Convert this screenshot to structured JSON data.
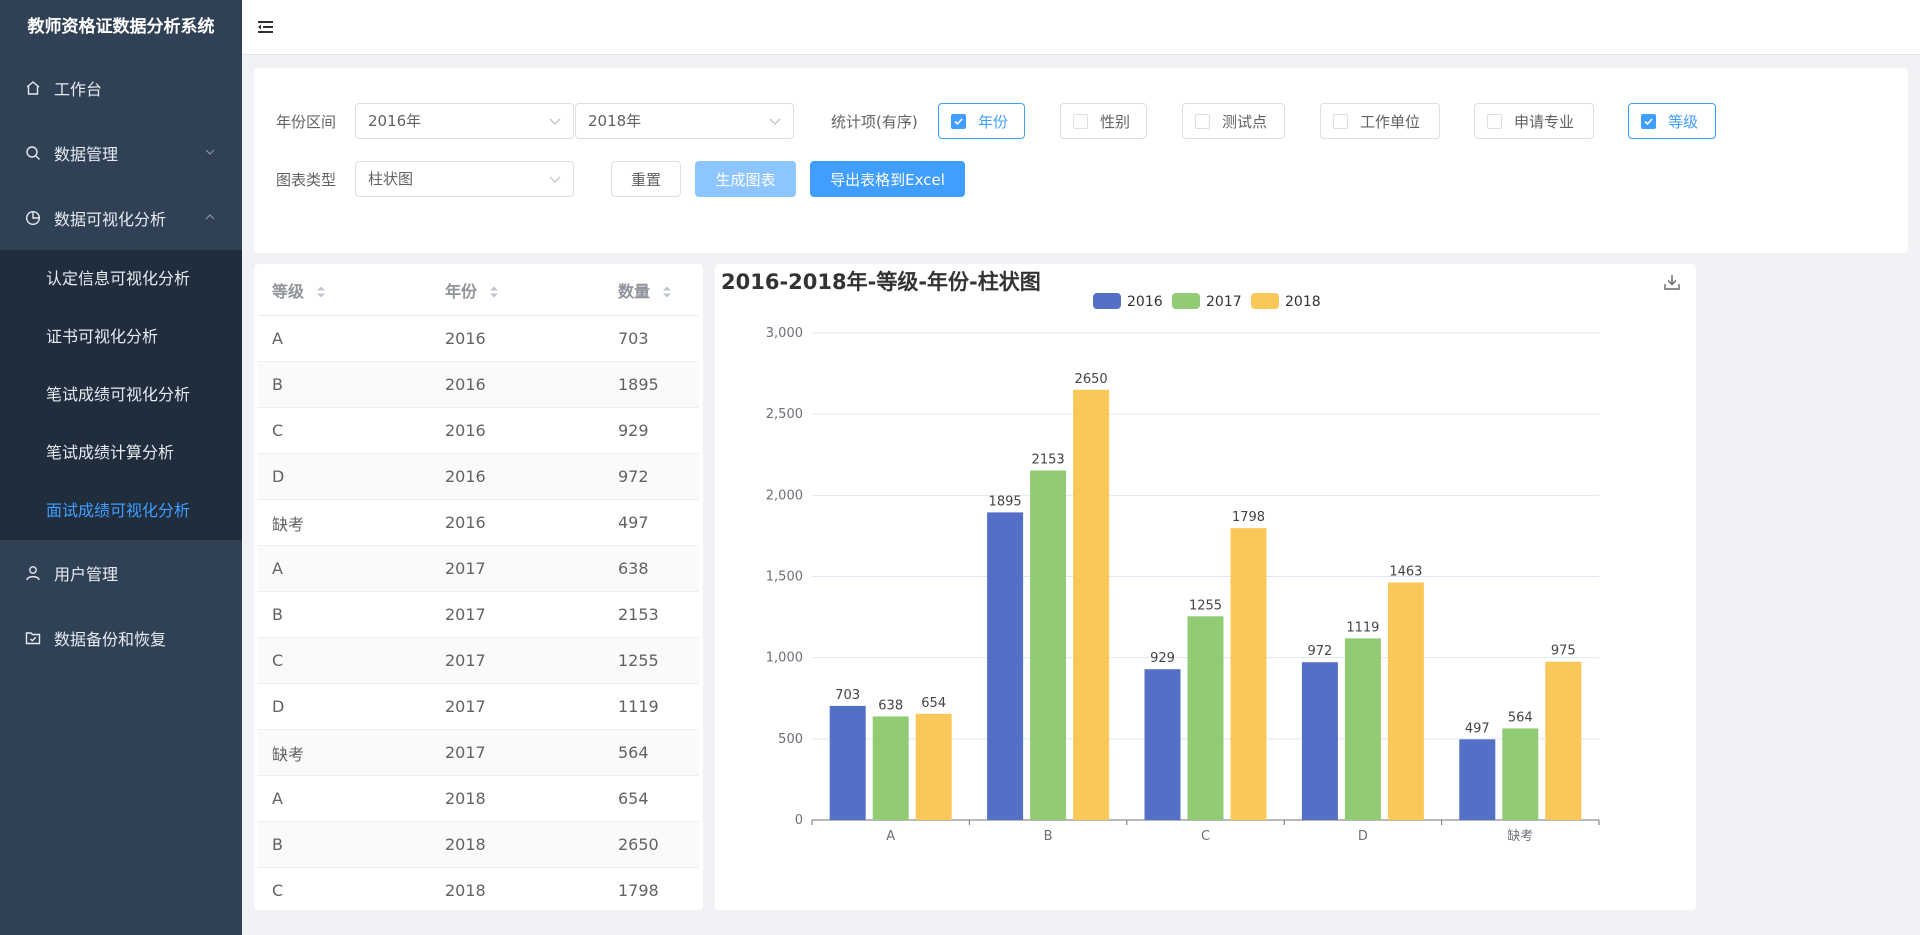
{
  "app": {
    "title": "教师资格证数据分析系统"
  },
  "sidebar": {
    "items": [
      {
        "label": "工作台"
      },
      {
        "label": "数据管理"
      },
      {
        "label": "数据可视化分析"
      },
      {
        "label": "用户管理"
      },
      {
        "label": "数据备份和恢复"
      }
    ],
    "subitems": [
      {
        "label": "认定信息可视化分析"
      },
      {
        "label": "证书可视化分析"
      },
      {
        "label": "笔试成绩可视化分析"
      },
      {
        "label": "笔试成绩计算分析"
      },
      {
        "label": "面试成绩可视化分析"
      }
    ]
  },
  "filters": {
    "year_range_label": "年份区间",
    "year_from": "2016年",
    "year_to": "2018年",
    "stats_label": "统计项(有序)",
    "options": [
      {
        "label": "年份",
        "checked": true
      },
      {
        "label": "性别",
        "checked": false
      },
      {
        "label": "测试点",
        "checked": false
      },
      {
        "label": "工作单位",
        "checked": false
      },
      {
        "label": "申请专业",
        "checked": false
      },
      {
        "label": "等级",
        "checked": true
      }
    ],
    "chart_type_label": "图表类型",
    "chart_type": "柱状图",
    "reset_label": "重置",
    "generate_label": "生成图表",
    "export_label": "导出表格到Excel"
  },
  "table": {
    "columns": [
      "等级",
      "年份",
      "数量"
    ],
    "rows": [
      [
        "A",
        "2016",
        "703"
      ],
      [
        "B",
        "2016",
        "1895"
      ],
      [
        "C",
        "2016",
        "929"
      ],
      [
        "D",
        "2016",
        "972"
      ],
      [
        "缺考",
        "2016",
        "497"
      ],
      [
        "A",
        "2017",
        "638"
      ],
      [
        "B",
        "2017",
        "2153"
      ],
      [
        "C",
        "2017",
        "1255"
      ],
      [
        "D",
        "2017",
        "1119"
      ],
      [
        "缺考",
        "2017",
        "564"
      ],
      [
        "A",
        "2018",
        "654"
      ],
      [
        "B",
        "2018",
        "2650"
      ],
      [
        "C",
        "2018",
        "1798"
      ]
    ]
  },
  "colors": {
    "primary": "#409eff",
    "sidebar_bg": "#304156",
    "submenu_bg": "#1f2d3d"
  },
  "chart_data": {
    "type": "bar",
    "title": "2016-2018年-等级-年份-柱状图",
    "categories": [
      "A",
      "B",
      "C",
      "D",
      "缺考"
    ],
    "series": [
      {
        "name": "2016",
        "color": "#5470c6",
        "values": [
          703,
          1895,
          929,
          972,
          497
        ]
      },
      {
        "name": "2017",
        "color": "#91cc75",
        "values": [
          638,
          2153,
          1255,
          1119,
          564
        ]
      },
      {
        "name": "2018",
        "color": "#fac858",
        "values": [
          654,
          2650,
          1798,
          1463,
          975
        ]
      }
    ],
    "yticks": [
      "0",
      "500",
      "1,000",
      "1,500",
      "2,000",
      "2,500",
      "3,000"
    ],
    "ylim": [
      0,
      3000
    ],
    "grid": true,
    "legend": "top-center"
  }
}
